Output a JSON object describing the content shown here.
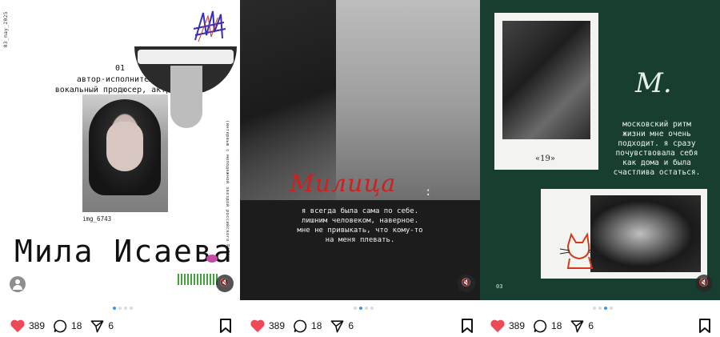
{
  "posts": [
    {
      "date": "03_may_2025",
      "number": "01",
      "roles_line1": "автор-исполнитель,",
      "roles_line2": "вокальный продюсер, актриса",
      "photo_caption": "img_6743",
      "side_text": "(интервью с молодежной звездой российского R&B)",
      "name": "Мила Исаева",
      "likes": "389",
      "comments": "18",
      "shares": "6",
      "dots_total": 4,
      "dots_active": 0
    },
    {
      "title": "Милица",
      "quote_lines": [
        "я всегда была сама по себе.",
        "лишним человеком, наверное.",
        "мне не привыкать, что кому-то",
        "на меня плевать."
      ],
      "likes": "389",
      "comments": "18",
      "shares": "6",
      "dots_active": 1
    },
    {
      "logo": "M.",
      "photo_label": "«19»",
      "quote_lines": [
        "московский ритм",
        "жизни мне очень",
        "подходит. я сразу",
        "почувствовала себя",
        "как дома и была",
        "счастлива остаться."
      ],
      "number": "03",
      "likes": "389",
      "comments": "18",
      "shares": "6",
      "dots_active": 2
    }
  ],
  "colors": {
    "accent_red": "#ed4956",
    "milica_red": "#d11f1f",
    "post3_bg": "#173e2f",
    "dot_active": "#3897f0"
  },
  "icons": [
    "heart-icon",
    "comment-icon",
    "share-icon",
    "bookmark-icon",
    "mute-icon",
    "avatar-icon"
  ]
}
